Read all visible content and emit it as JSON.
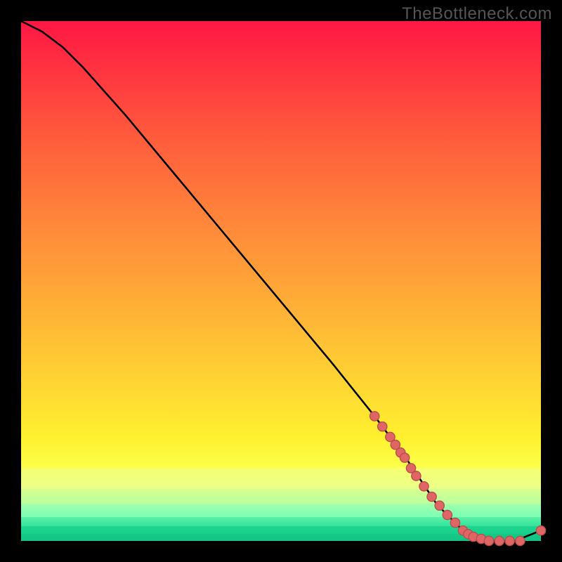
{
  "watermark": "TheBottleneck.com",
  "colors": {
    "bg": "#000000",
    "curve": "#000000",
    "marker_fill": "#e06666",
    "marker_stroke": "#b94c4c"
  },
  "chart_data": {
    "type": "line",
    "title": "",
    "xlabel": "",
    "ylabel": "",
    "xlim": [
      0,
      100
    ],
    "ylim": [
      0,
      100
    ],
    "series": [
      {
        "name": "bottleneck-curve",
        "x": [
          0,
          4,
          8,
          12,
          20,
          30,
          40,
          50,
          60,
          68,
          74,
          80,
          85,
          90,
          95,
          100
        ],
        "y": [
          100,
          98,
          95,
          91,
          82,
          70,
          58,
          46,
          34,
          24,
          16,
          7,
          2,
          0,
          0,
          2
        ]
      }
    ],
    "markers": {
      "name": "highlighted-points",
      "x": [
        68,
        69.5,
        71,
        72,
        73,
        73.8,
        75,
        76,
        77.5,
        79,
        80.5,
        82,
        83.5,
        85,
        86,
        87,
        88.5,
        90,
        92,
        94,
        96,
        100
      ],
      "y": [
        24,
        22,
        20,
        18.5,
        17,
        16,
        14,
        12.5,
        10.5,
        8.5,
        6.8,
        5,
        3.5,
        2,
        1.3,
        0.8,
        0.4,
        0,
        0,
        0,
        0,
        2
      ]
    }
  },
  "gradient_bands": [
    {
      "from": "#ff1744",
      "to": "#ff5a3c",
      "top": 0,
      "height": 22
    },
    {
      "from": "#ff5a3c",
      "to": "#ff8a3a",
      "top": 22,
      "height": 18
    },
    {
      "from": "#ff8a3a",
      "to": "#ffb236",
      "top": 40,
      "height": 16
    },
    {
      "from": "#ffb236",
      "to": "#ffd633",
      "top": 56,
      "height": 14
    },
    {
      "from": "#ffd633",
      "to": "#fff02f",
      "top": 70,
      "height": 10
    },
    {
      "from": "#fff02f",
      "to": "#fcff4a",
      "top": 80,
      "height": 6
    },
    {
      "from": "#f6ff70",
      "to": "#eaff8a",
      "top": 86,
      "height": 4
    },
    {
      "from": "#d6ff8f",
      "to": "#baffa0",
      "top": 90,
      "height": 3
    },
    {
      "from": "#9effac",
      "to": "#7dffb6",
      "top": 93,
      "height": 2.4
    },
    {
      "from": "#5cf2a8",
      "to": "#33e39b",
      "top": 95.4,
      "height": 1.8
    },
    {
      "from": "#1fd690",
      "to": "#18cf8c",
      "top": 97.2,
      "height": 1.4
    },
    {
      "from": "#14c987",
      "to": "#12c485",
      "top": 98.6,
      "height": 1.4
    }
  ]
}
